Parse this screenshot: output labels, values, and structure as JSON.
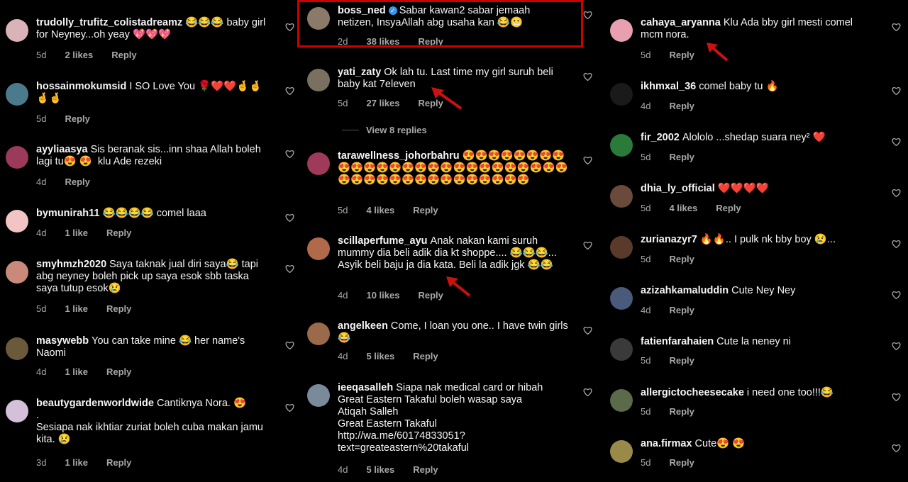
{
  "colors": {
    "background": "#000000",
    "text": "#f5f5f5",
    "meta": "#a8a8a8",
    "verified": "#3897f0",
    "highlight": "#cc0000",
    "arrow": "#cc1111"
  },
  "column1": [
    {
      "user": "trudolly_trufitz_colistadreamz",
      "text": "😂😂😂 baby girl for Neyney...oh yeay 💖💖💖",
      "age": "5d",
      "likes": "2 likes",
      "reply": "Reply",
      "avatar": "#d9b3b8"
    },
    {
      "user": "hossainmokumsid",
      "text": "I SO Love You 🌹❤️❤️🤞🤞🤞🤞",
      "age": "5d",
      "likes": "",
      "reply": "Reply",
      "avatar": "#4a7a8c"
    },
    {
      "user": "ayyliaasya",
      "text": "Sis beranak sis...inn shaa Allah boleh lagi tu😍 😍  klu Ade rezeki",
      "age": "4d",
      "likes": "",
      "reply": "Reply",
      "avatar": "#9b3a5a"
    },
    {
      "user": "bymunirah11",
      "text": "😂😂😂😂 comel laaa",
      "age": "4d",
      "likes": "1 like",
      "reply": "Reply",
      "avatar": "#f2c4c4"
    },
    {
      "user": "smyhmzh2020",
      "text": "Saya taknak jual diri saya😂 tapi abg neyney boleh pick up saya esok sbb taska saya tutup esok😢",
      "age": "5d",
      "likes": "1 like",
      "reply": "Reply",
      "avatar": "#c98a7a"
    },
    {
      "user": "masywebb",
      "text": "You can take mine 😂 her name's Naomi",
      "age": "4d",
      "likes": "1 like",
      "reply": "Reply",
      "avatar": "#6b5a3a"
    },
    {
      "user": "beautygardenworldwide",
      "text": "Cantiknya Nora. 😍\n.\nSesiapa nak ikhtiar zuriat boleh cuba makan jamu kita. 😢",
      "age": "3d",
      "likes": "1 like",
      "reply": "Reply",
      "avatar": "#d4c0d8"
    }
  ],
  "column2": [
    {
      "user": "boss_ned",
      "verified": "✓",
      "text": "Sabar kawan2 sabar jemaah netizen, InsyaAllah abg usaha kan 😂😬",
      "age": "2d",
      "likes": "38 likes",
      "reply": "Reply",
      "avatar": "#8a7a6a"
    },
    {
      "user": "yati_zaty",
      "text": "Ok lah tu. Last time my girl suruh beli baby kat 7eleven",
      "age": "5d",
      "likes": "27 likes",
      "reply": "Reply",
      "avatar": "#7a7060"
    },
    {
      "user": "tarawellness_johorbahru",
      "text": "😍😍😍😍😍😍😍😍😍😍😍😍😍😍😍😍😍😍😍😍😍😍😍😍😍😍😍😍😍😍😍😍😍😍😍😍😍😍😍😍😍",
      "age": "5d",
      "likes": "4 likes",
      "reply": "Reply",
      "avatar": "#a03a5a"
    },
    {
      "user": "scillaperfume_ayu",
      "text": "Anak nakan kami suruh mummy dia beli adik dia kt shoppe.... 😂😂😂... Asyik beli baju ja dia kata. Beli la adik jgk 😂😂",
      "age": "4d",
      "likes": "10 likes",
      "reply": "Reply",
      "avatar": "#b06a4a"
    },
    {
      "user": "angelkeen",
      "text": "Come, I loan you one.. I have twin girls 😂",
      "age": "4d",
      "likes": "5 likes",
      "reply": "Reply",
      "avatar": "#9a6a4a"
    },
    {
      "user": "ieeqasalleh",
      "text": "Siapa nak medical card or hibah Great Eastern Takaful boleh wasap saya\nAtiqah Salleh\nGreat Eastern Takaful\nhttp://wa.me/60174833051?\ntext=greateastern%20takaful",
      "age": "4d",
      "likes": "5 likes",
      "reply": "Reply",
      "avatar": "#7a8a9a"
    }
  ],
  "view_replies": "View 8 replies",
  "column3": [
    {
      "user": "cahaya_aryanna",
      "text": "Klu Ada bby girl mesti comel mcm nora.",
      "age": "5d",
      "likes": "",
      "reply": "Reply",
      "avatar": "#e8a0b0"
    },
    {
      "user": "ikhmxal_36",
      "text": "comel baby tu 🔥",
      "age": "4d",
      "likes": "",
      "reply": "Reply",
      "avatar": "#1a1a1a"
    },
    {
      "user": "fir_2002",
      "text": "Alololo ...shedap suara ney² ❤️",
      "age": "5d",
      "likes": "",
      "reply": "Reply",
      "avatar": "#2a7a3a"
    },
    {
      "user": "dhia_ly_official",
      "text": "❤️❤️❤️❤️",
      "age": "5d",
      "likes": "4 likes",
      "reply": "Reply",
      "avatar": "#6a4a3a"
    },
    {
      "user": "zurianazyr7",
      "text": "🔥🔥.. I pulk nk bby boy 😢...",
      "age": "5d",
      "likes": "",
      "reply": "Reply",
      "avatar": "#5a3a2a"
    },
    {
      "user": "azizahkamaluddin",
      "text": "Cute Ney Ney",
      "age": "4d",
      "likes": "",
      "reply": "Reply",
      "avatar": "#4a5a7a"
    },
    {
      "user": "fatienfarahaien",
      "text": "Cute la neney ni",
      "age": "5d",
      "likes": "",
      "reply": "Reply",
      "avatar": "#3a3a3a"
    },
    {
      "user": "allergictocheesecake",
      "text": "i need one too!!!😂",
      "age": "5d",
      "likes": "",
      "reply": "Reply",
      "avatar": "#5a6a4a"
    },
    {
      "user": "ana.firmax",
      "text": "Cute😍 😍",
      "age": "5d",
      "likes": "",
      "reply": "Reply",
      "avatar": "#9a8a4a"
    }
  ]
}
